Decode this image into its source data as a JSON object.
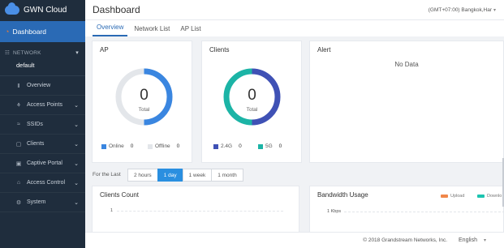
{
  "app": {
    "brand": "GWN Cloud",
    "brand_badge": "GWN"
  },
  "sidebar": {
    "dashboard_label": "Dashboard",
    "network_header": "NETWORK",
    "network_name": "default",
    "items": [
      {
        "label": "Overview",
        "icon": "bar-chart-icon",
        "glyph": "Ⅱ",
        "has_chevron": false
      },
      {
        "label": "Access Points",
        "icon": "access-point-icon",
        "glyph": "⚘",
        "has_chevron": true
      },
      {
        "label": "SSIDs",
        "icon": "wifi-icon",
        "glyph": "≈",
        "has_chevron": true
      },
      {
        "label": "Clients",
        "icon": "clients-icon",
        "glyph": "▢",
        "has_chevron": true
      },
      {
        "label": "Captive Portal",
        "icon": "portal-icon",
        "glyph": "▣",
        "has_chevron": true
      },
      {
        "label": "Access Control",
        "icon": "lock-icon",
        "glyph": "⌂",
        "has_chevron": true
      },
      {
        "label": "System",
        "icon": "gear-icon",
        "glyph": "⚙",
        "has_chevron": true
      }
    ]
  },
  "header": {
    "title": "Dashboard",
    "timezone": "(GMT+07:00) Bangkok,Har"
  },
  "tabs": [
    {
      "label": "Overview",
      "active": true
    },
    {
      "label": "Network List",
      "active": false
    },
    {
      "label": "AP List",
      "active": false
    }
  ],
  "ap_card": {
    "title": "AP",
    "value": "0",
    "total_label": "Total",
    "legend": [
      {
        "label": "Online",
        "count": "0",
        "color": "#3a86e0"
      },
      {
        "label": "Offline",
        "count": "0",
        "color": "#e3e6ea"
      }
    ]
  },
  "clients_card": {
    "title": "Clients",
    "value": "0",
    "total_label": "Total",
    "legend": [
      {
        "label": "2.4G",
        "count": "0",
        "color": "#3f51b5"
      },
      {
        "label": "5G",
        "count": "0",
        "color": "#1cb4a6"
      }
    ]
  },
  "alert_card": {
    "title": "Alert",
    "empty_text": "No Data"
  },
  "time_range": {
    "label": "For the Last",
    "options": [
      {
        "label": "2 hours",
        "active": false
      },
      {
        "label": "1 day",
        "active": true
      },
      {
        "label": "1 week",
        "active": false
      },
      {
        "label": "1 month",
        "active": false
      }
    ]
  },
  "clients_count": {
    "title": "Clients Count",
    "tick": "1"
  },
  "bandwidth": {
    "title": "Bandwidth Usage",
    "tick": "1 Kbps",
    "legend": [
      {
        "label": "Upload",
        "color": "#f0874a"
      },
      {
        "label": "Downlo",
        "color": "#1cc4b0"
      }
    ]
  },
  "footer": {
    "copyright": "© 2018 Grandstream Networks, Inc.",
    "language": "English"
  },
  "colors": {
    "sidebar_bg": "#1f2d3d",
    "active_nav": "#2a6ab5",
    "accent": "#2a8fe0"
  }
}
